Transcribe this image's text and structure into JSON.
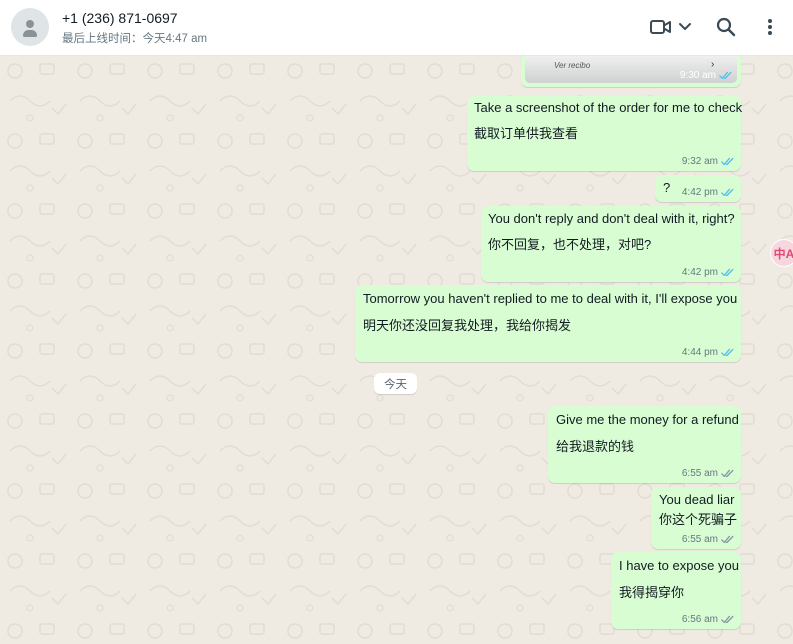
{
  "header": {
    "contact_name": "+1 (236) 871-0697",
    "last_seen": "最后上线时间：今天4:47 am",
    "icons": [
      "avatar-icon",
      "video-call-icon",
      "chevron-down-icon",
      "search-icon",
      "more-vertical-icon"
    ]
  },
  "image_message": {
    "caption": "Ver recibo",
    "time": "9:30 am",
    "status": "read"
  },
  "messages": [
    {
      "line1": "Take a screenshot of the order for me to check",
      "line2": "截取订单供我查看",
      "time": "9:32 am",
      "status": "read"
    },
    {
      "line1": "?",
      "time": "4:42 pm",
      "status": "read"
    },
    {
      "line1": "You don't reply and don't deal with it, right?",
      "line2": "你不回复，也不处理，对吧?",
      "time": "4:42 pm",
      "status": "read"
    },
    {
      "line1": "Tomorrow you haven't replied to me to deal with it, I'll expose you",
      "line2": "明天你还没回复我处理，我给你揭发",
      "time": "4:44 pm",
      "status": "read"
    },
    {
      "line1": "Give me the money for a refund",
      "line2": "给我退款的钱",
      "time": "6:55 am",
      "status": "delivered"
    },
    {
      "line1": "You dead liar",
      "line2": "你这个死骗子",
      "time": "6:55 am",
      "status": "delivered"
    },
    {
      "line1": "I have to expose you",
      "line2": "我得揭穿你",
      "time": "6:56 am",
      "status": "delivered"
    }
  ],
  "date_divider": "今天",
  "translate_button": {
    "label": "中A"
  },
  "colors": {
    "outgoing_bubble": "#d9fdd3",
    "chat_background": "#efeae2",
    "read_tick": "#53bdeb",
    "delivered_tick": "#8696a0"
  }
}
